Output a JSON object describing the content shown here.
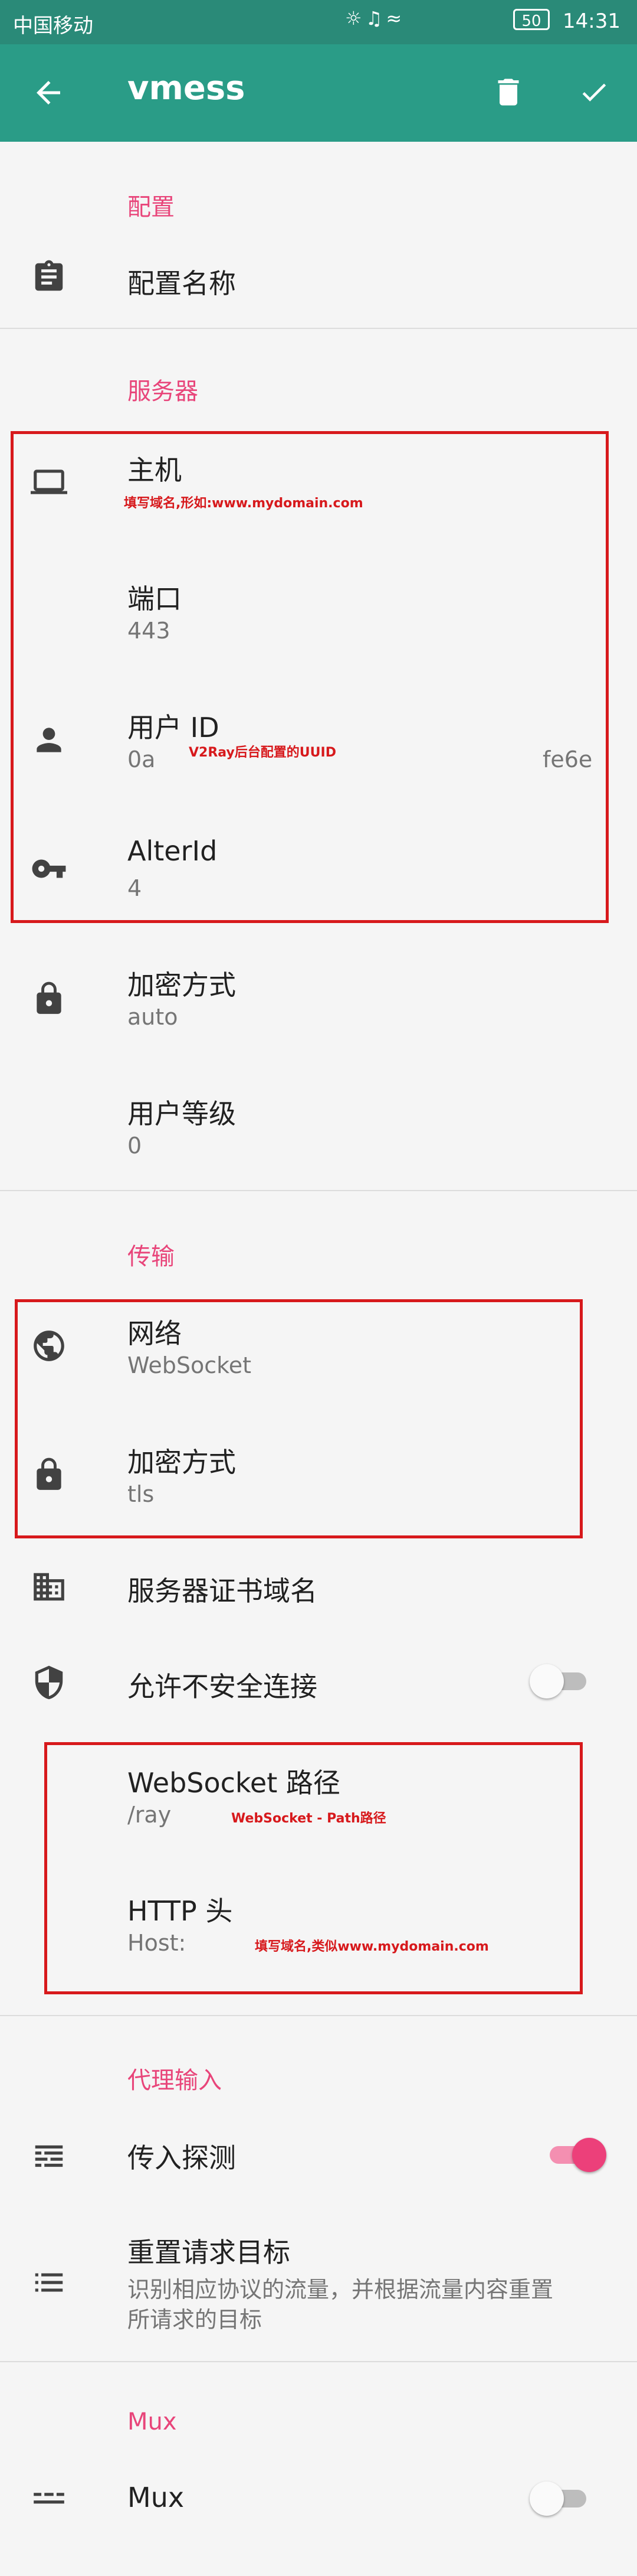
{
  "status_bar": {
    "carrier": "中国移动",
    "battery": "50",
    "time": "14:31"
  },
  "app_bar": {
    "title": "vmess"
  },
  "sections": {
    "config": "配置",
    "server": "服务器",
    "transport": "传输",
    "proxy_input": "代理输入",
    "mux": "Mux"
  },
  "config": {
    "name_label": "配置名称"
  },
  "server": {
    "host_label": "主机",
    "host_value": "",
    "port_label": "端口",
    "port_value": "443",
    "uuid_label": "用户 ID",
    "uuid_value": "0a",
    "uuid_value_tail": "fe6e",
    "alterid_label": "AlterId",
    "alterid_value": "4",
    "security_label": "加密方式",
    "security_value": "auto",
    "level_label": "用户等级",
    "level_value": "0"
  },
  "transport": {
    "network_label": "网络",
    "network_value": "WebSocket",
    "security_label": "加密方式",
    "security_value": "tls",
    "sni_label": "服务器证书域名",
    "insecure_label": "允许不安全连接",
    "insecure_enabled": false,
    "ws_path_label": "WebSocket 路径",
    "ws_path_value": "/ray",
    "http_header_label": "HTTP 头",
    "http_header_value": "Host: "
  },
  "proxy_input": {
    "sniffing_label": "传入探测",
    "sniffing_enabled": true,
    "route_label": "重置请求目标",
    "route_desc_line1": "识别相应协议的流量，并根据流量内容重置",
    "route_desc_line2": "所请求的目标"
  },
  "mux": {
    "label": "Mux",
    "enabled": false
  },
  "annotations": {
    "host_note": "填写域名,形如:www.mydomain.com",
    "uuid_note": "V2Ray后台配置的UUID",
    "path_note": "WebSocket - Path路径",
    "header_note": "填写域名,类似www.mydomain.com"
  },
  "colors": {
    "app_bar": "#2a9c87",
    "status_bar": "#2a8a78",
    "accent": "#e8457a",
    "annotation": "#d7191c"
  },
  "icons": {
    "back": "arrow-back-icon",
    "delete": "trash-icon",
    "save": "check-icon",
    "config_name": "clipboard-icon",
    "host": "laptop-icon",
    "user_id": "person-icon",
    "alter_id": "key-icon",
    "security": "lock-icon",
    "network": "globe-icon",
    "tls": "lock-icon",
    "sni": "building-icon",
    "insecure": "shield-icon",
    "sniffing": "dns-icon",
    "route": "list-icon",
    "mux": "mux-icon"
  }
}
